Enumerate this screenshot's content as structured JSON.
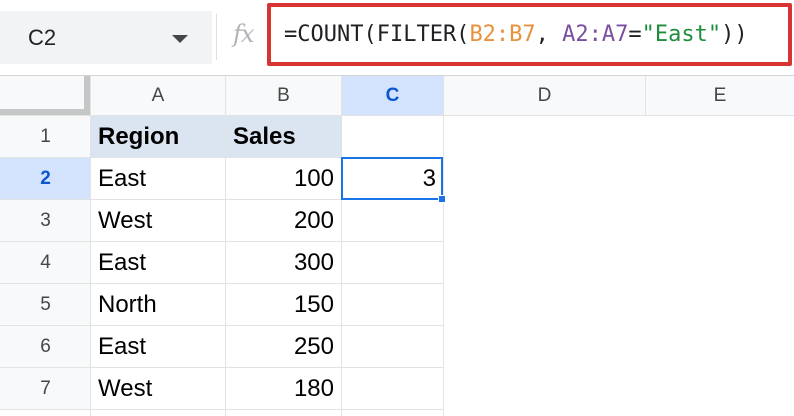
{
  "name_box": {
    "value": "C2"
  },
  "formula_bar": {
    "fx_label": "fx",
    "tokens": {
      "t1": "=COUNT(FILTER(",
      "t2": "B2:B7",
      "t3": ", ",
      "t4": "A2:A7",
      "t5": "=",
      "t6": "\"East\"",
      "t7": "))"
    }
  },
  "columns": [
    "A",
    "B",
    "C",
    "D",
    "E"
  ],
  "active_column": "C",
  "rows": [
    "1",
    "2",
    "3",
    "4",
    "5",
    "6",
    "7"
  ],
  "active_row": "2",
  "table": {
    "headers": [
      "Region",
      "Sales"
    ],
    "data": [
      [
        "East",
        "100"
      ],
      [
        "West",
        "200"
      ],
      [
        "East",
        "300"
      ],
      [
        "North",
        "150"
      ],
      [
        "East",
        "250"
      ],
      [
        "West",
        "180"
      ]
    ]
  },
  "selected_cell": {
    "address": "C2",
    "value": "3"
  },
  "colors": {
    "highlight_border": "#d93434",
    "selection": "#1a73e8",
    "header_fill": "#dbe5f1",
    "active_header": "#d3e3fd"
  }
}
